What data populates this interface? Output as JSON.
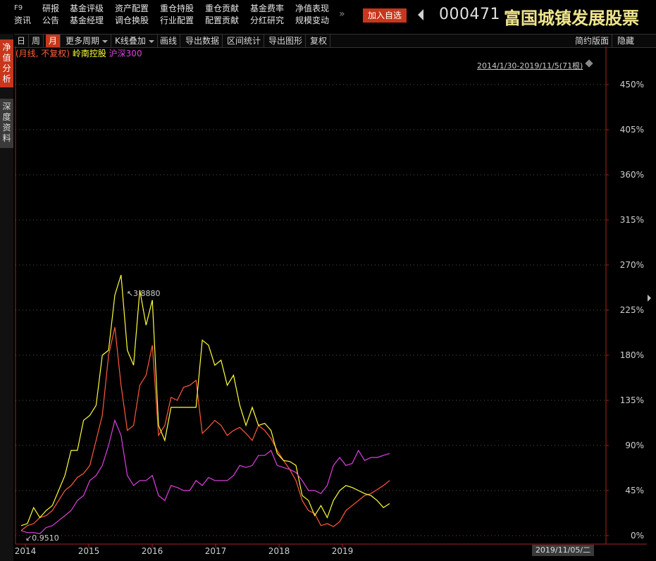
{
  "header": {
    "f9_label": "F9",
    "nav_columns": [
      [
        "资讯",
        ""
      ],
      [
        "研报",
        "公告"
      ],
      [
        "基金评级",
        "基金经理"
      ],
      [
        "资产配置",
        "调仓换股"
      ],
      [
        "重仓持股",
        "行业配置"
      ],
      [
        "重仓贡献",
        "配置贡献"
      ],
      [
        "基金费率",
        "分红研究"
      ],
      [
        "净值表现",
        "规模变动"
      ]
    ],
    "more_label": "»",
    "add_favorite_label": "加入自选",
    "fund_code": "000471",
    "fund_name": "富国城镇发展股票"
  },
  "side_tabs": {
    "nav_analysis": "净值分析",
    "depth_data": "深度资料"
  },
  "toolbar": {
    "items": [
      "日",
      "周",
      "月",
      "更多周期",
      "K线叠加",
      "画线",
      "导出数据",
      "区间统计",
      "导出图形",
      "复权"
    ],
    "active": "月",
    "right_items": [
      "简约版面",
      "隐藏"
    ]
  },
  "legend": {
    "mode": "(月线, 不复权)",
    "series1": "岭南控股",
    "series2": "沪深300"
  },
  "range_label": "2014/1/30-2019/11/5(71根)",
  "cursor_date": "2019/11/05/二",
  "chart_data": {
    "type": "line",
    "x_labels": [
      "2014",
      "2015",
      "2016",
      "2017",
      "2018",
      "2019"
    ],
    "y_ticks": [
      "0%",
      "45%",
      "90%",
      "135%",
      "180%",
      "225%",
      "270%",
      "315%",
      "360%",
      "405%",
      "450%"
    ],
    "ylim": [
      0,
      450
    ],
    "annotations": {
      "max": "3.8880",
      "min": "0.9510"
    },
    "colors": {
      "fund": "#ff5a3c",
      "stock": "#ffff3c",
      "index": "#e040e0",
      "grid": "#555555",
      "axis": "#aa2222"
    },
    "series": [
      {
        "name": "",
        "color": "#ff5a3c",
        "values": [
          5,
          10,
          12,
          18,
          20,
          25,
          35,
          45,
          50,
          58,
          62,
          70,
          95,
          120,
          180,
          208,
          150,
          105,
          110,
          150,
          160,
          190,
          100,
          110,
          138,
          135,
          148,
          150,
          155,
          102,
          108,
          115,
          110,
          100,
          105,
          108,
          102,
          95,
          110,
          105,
          97,
          85,
          75,
          66,
          55,
          35,
          25,
          22,
          10,
          12,
          9,
          14,
          25,
          30,
          35,
          40,
          42,
          46,
          50,
          55
        ]
      },
      {
        "name": "岭南控股",
        "color": "#ffff3c",
        "values": [
          10,
          12,
          28,
          18,
          25,
          30,
          45,
          60,
          85,
          85,
          115,
          120,
          130,
          180,
          185,
          240,
          260,
          185,
          170,
          245,
          210,
          235,
          110,
          95,
          128,
          128,
          128,
          128,
          128,
          195,
          190,
          170,
          175,
          150,
          160,
          130,
          110,
          128,
          110,
          112,
          105,
          82,
          75,
          74,
          70,
          40,
          35,
          20,
          30,
          18,
          35,
          45,
          50,
          48,
          45,
          42,
          40,
          35,
          28,
          32
        ]
      },
      {
        "name": "沪深300",
        "color": "#e040e0",
        "values": [
          5,
          3,
          3,
          2,
          8,
          10,
          15,
          20,
          25,
          35,
          40,
          55,
          60,
          70,
          90,
          115,
          100,
          60,
          50,
          55,
          55,
          60,
          40,
          35,
          50,
          48,
          45,
          45,
          55,
          50,
          58,
          55,
          55,
          55,
          60,
          70,
          68,
          70,
          80,
          80,
          85,
          70,
          68,
          66,
          63,
          55,
          45,
          45,
          42,
          50,
          70,
          78,
          70,
          72,
          85,
          75,
          78,
          78,
          80,
          82
        ]
      }
    ]
  }
}
